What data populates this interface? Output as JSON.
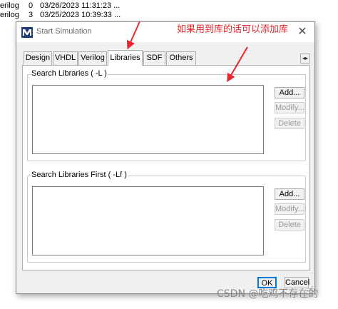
{
  "background_list": {
    "rows": [
      {
        "type": "erilog",
        "version": "0",
        "date": "03/26/2023 11:31:23 ..."
      },
      {
        "type": "erilog",
        "version": "3",
        "date": "03/25/2023 10:39:33 ..."
      }
    ]
  },
  "dialog": {
    "title": "Start Simulation",
    "close_glyph": "✕",
    "tabs": [
      {
        "label": "Design"
      },
      {
        "label": "VHDL"
      },
      {
        "label": "Verilog"
      },
      {
        "label": "Libraries"
      },
      {
        "label": "SDF"
      },
      {
        "label": "Others"
      }
    ],
    "active_tab": "Libraries",
    "tab_scroll_glyph": "◂▸",
    "search_libraries": {
      "label": "Search Libraries ( -L )",
      "items": [],
      "buttons": {
        "add": "Add...",
        "modify": "Modify...",
        "delete": "Delete"
      }
    },
    "search_libraries_first": {
      "label": "Search Libraries First ( -Lf )",
      "items": [],
      "buttons": {
        "add": "Add...",
        "modify": "Modify...",
        "delete": "Delete"
      }
    },
    "footer": {
      "ok": "OK",
      "cancel": "Cancel"
    }
  },
  "annotation": {
    "text": "如果用到库的话可以添加库",
    "color": "#e6262c"
  },
  "watermark": {
    "text": "CSDN @吃鸡不存在的"
  },
  "colors": {
    "accent": "#0078d7",
    "annotation_red": "#e6262c",
    "disabled_text": "#9a9a9a"
  },
  "icons": {
    "app": "modelsim-m-icon"
  }
}
